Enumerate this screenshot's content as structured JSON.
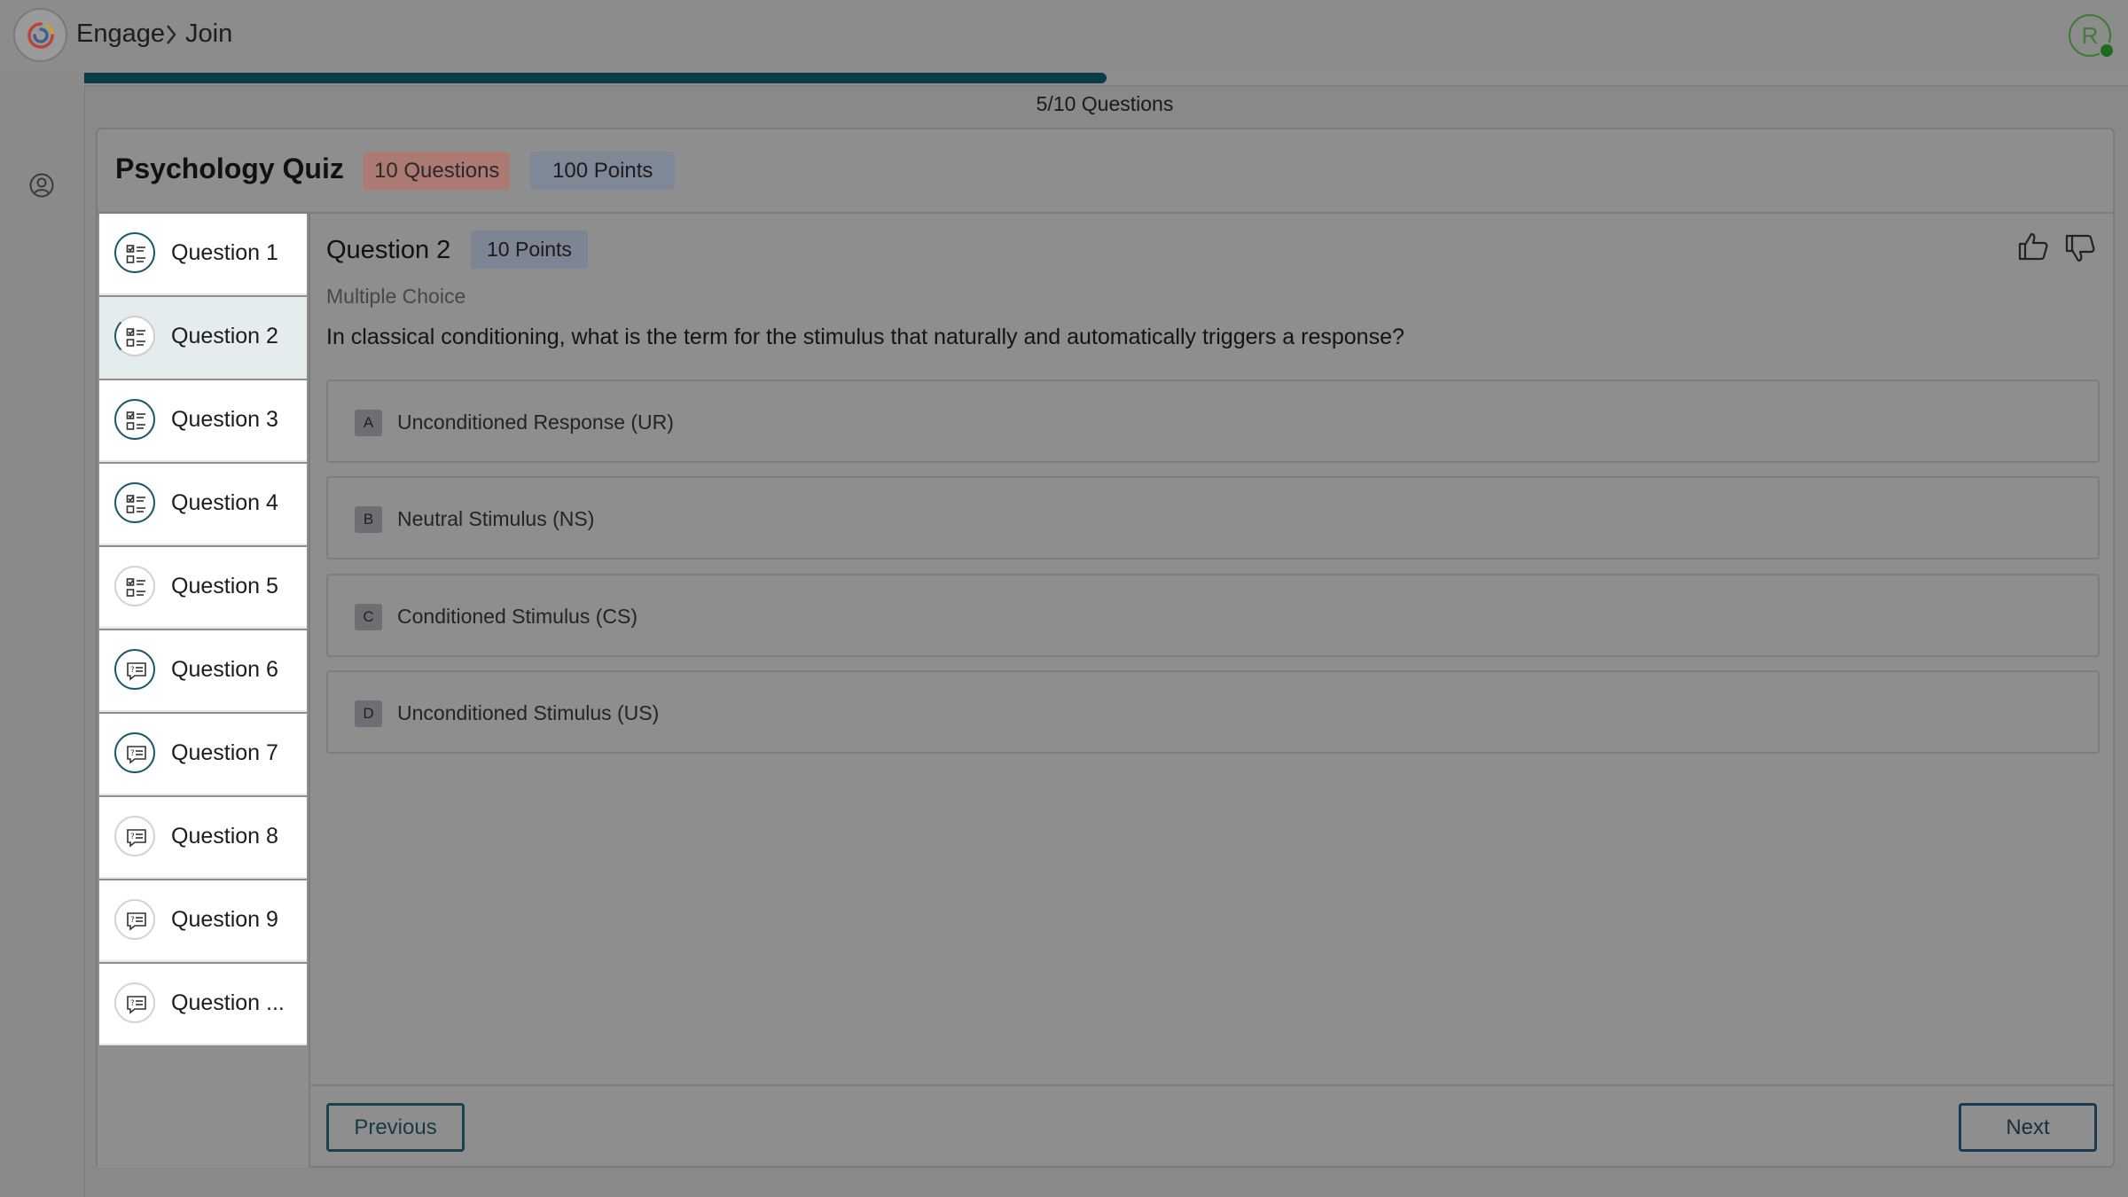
{
  "header": {
    "breadcrumb": [
      "Engage",
      "Join"
    ],
    "avatar_initial": "R"
  },
  "progress": {
    "fraction": 0.5,
    "label": "5/10 Questions"
  },
  "quiz": {
    "title": "Psychology Quiz",
    "questions_badge": "10 Questions",
    "points_badge": "100 Points"
  },
  "sidebar": {
    "items": [
      {
        "label": "Question 1",
        "icon": "checklist-icon"
      },
      {
        "label": "Question 2",
        "icon": "checklist-icon",
        "active": true
      },
      {
        "label": "Question 3",
        "icon": "checklist-icon"
      },
      {
        "label": "Question 4",
        "icon": "checklist-icon"
      },
      {
        "label": "Question 5",
        "icon": "checklist-icon"
      },
      {
        "label": "Question 6",
        "icon": "speech-question-icon"
      },
      {
        "label": "Question 7",
        "icon": "speech-question-icon"
      },
      {
        "label": "Question 8",
        "icon": "speech-question-icon"
      },
      {
        "label": "Question 9",
        "icon": "speech-question-icon"
      },
      {
        "label": "Question ...",
        "icon": "speech-question-icon"
      }
    ]
  },
  "question": {
    "title": "Question 2",
    "points": "10 Points",
    "type": "Multiple Choice",
    "text": "In classical conditioning, what is the term for the stimulus that naturally and automatically triggers a response?",
    "options": [
      {
        "letter": "A",
        "text": "Unconditioned Response (UR)"
      },
      {
        "letter": "B",
        "text": "Neutral Stimulus (NS)"
      },
      {
        "letter": "C",
        "text": "Conditioned Stimulus (CS)"
      },
      {
        "letter": "D",
        "text": "Unconditioned Stimulus (US)"
      }
    ]
  },
  "nav": {
    "previous_label": "Previous",
    "next_label": "Next"
  },
  "colors": {
    "accent": "#0b3b46",
    "avatar": "#3e7d34"
  }
}
